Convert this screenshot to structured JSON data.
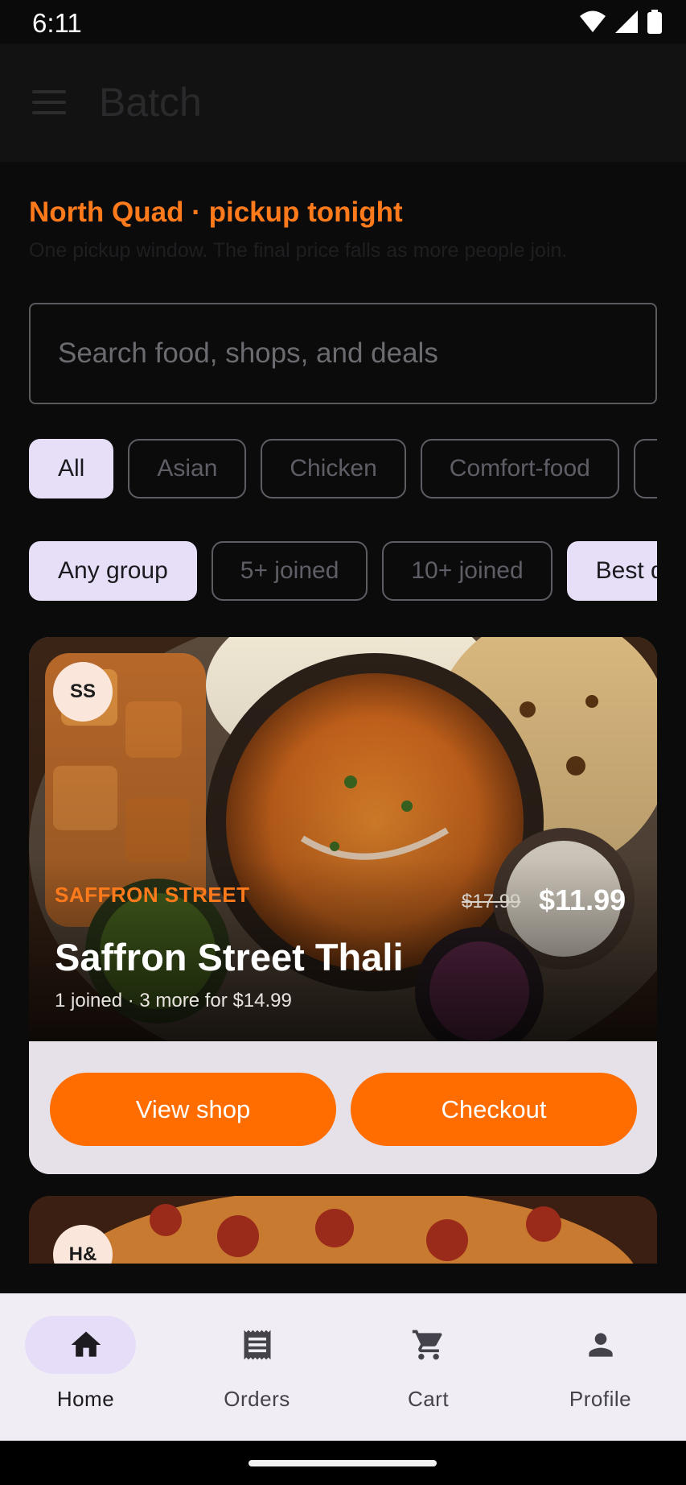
{
  "status_bar": {
    "time": "6:11"
  },
  "app_bar": {
    "title": "Batch"
  },
  "location": {
    "title": "North Quad · pickup tonight",
    "subtitle": "One pickup window. The final price falls as more people join."
  },
  "search": {
    "placeholder": "Search food, shops, and deals"
  },
  "category_chips": [
    {
      "label": "All",
      "selected": true
    },
    {
      "label": "Asian",
      "selected": false
    },
    {
      "label": "Chicken",
      "selected": false
    },
    {
      "label": "Comfort-food",
      "selected": false
    },
    {
      "label": "",
      "selected": false
    }
  ],
  "group_chips": [
    {
      "label": "Any group",
      "selected": true
    },
    {
      "label": "5+ joined",
      "selected": false
    },
    {
      "label": "10+ joined",
      "selected": false
    },
    {
      "label": "Best deals",
      "selected": true
    }
  ],
  "deals": [
    {
      "badge": "SS",
      "shop": "SAFFRON STREET",
      "title": "Saffron Street Thali",
      "meta": "1 joined · 3 more for $14.99",
      "price_original": "$17.99",
      "price_current": "$11.99",
      "view_label": "View shop",
      "checkout_label": "Checkout"
    },
    {
      "badge": "H&"
    }
  ],
  "bottom_nav": [
    {
      "label": "Home",
      "icon": "home-icon",
      "active": true
    },
    {
      "label": "Orders",
      "icon": "receipt-icon",
      "active": false
    },
    {
      "label": "Cart",
      "icon": "cart-icon",
      "active": false
    },
    {
      "label": "Profile",
      "icon": "person-icon",
      "active": false
    }
  ],
  "colors": {
    "accent": "#ff6d00",
    "chip_selected": "#e6dff7",
    "nav_background": "#f1edf4"
  }
}
